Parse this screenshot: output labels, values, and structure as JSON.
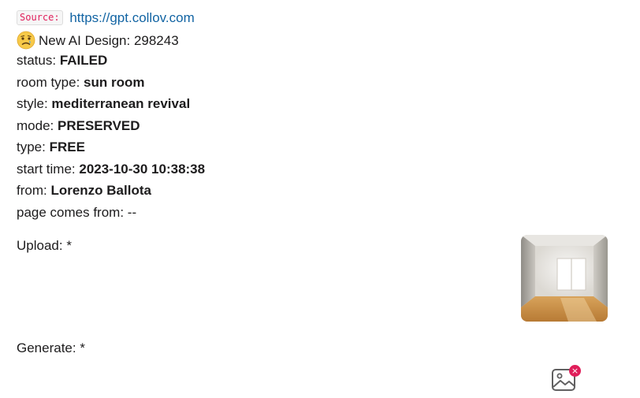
{
  "message": {
    "source_tag": "Source:",
    "source_url": "https://gpt.collov.com",
    "emoji_icon": "crying-face-icon",
    "title": "New AI Design: 298243",
    "fields": [
      {
        "label": "status: ",
        "value": "FAILED"
      },
      {
        "label": "room type: ",
        "value": "sun room"
      },
      {
        "label": "style: ",
        "value": "mediterranean revival"
      },
      {
        "label": "mode: ",
        "value": "PRESERVED"
      },
      {
        "label": "type: ",
        "value": "FREE"
      },
      {
        "label": "start time: ",
        "value": "2023-10-30 10:38:38"
      },
      {
        "label": "from: ",
        "value": "Lorenzo Ballota"
      }
    ],
    "page_from_label": "page comes from: --",
    "upload_label": "Upload: *",
    "generate_label": "Generate: *",
    "upload_thumbnail": "empty-room-photo",
    "generate_image_icon": "broken-image-icon",
    "error_badge": "×"
  },
  "colors": {
    "link": "#1264a3",
    "code_text": "#e01e5a",
    "badge": "#e01e5a"
  }
}
